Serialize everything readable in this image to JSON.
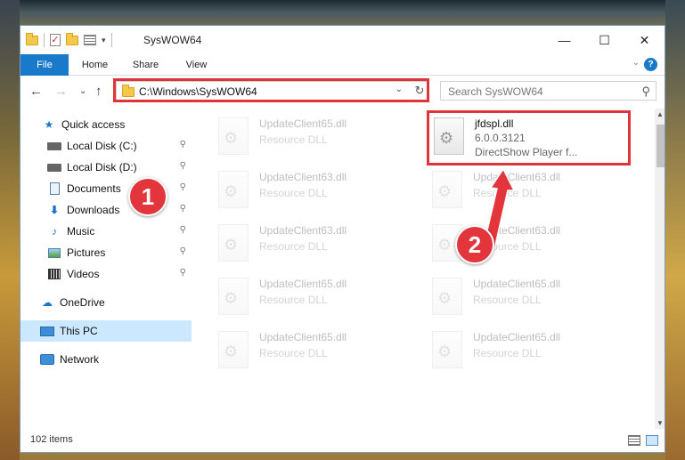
{
  "window": {
    "title": "SysWOW64",
    "controls": {
      "minimize": "—",
      "maximize": "☐",
      "close": "✕"
    }
  },
  "ribbon": {
    "tabs": [
      "File",
      "Home",
      "Share",
      "View"
    ],
    "help": "?",
    "collapse": "⌄"
  },
  "nav": {
    "back": "←",
    "forward": "→",
    "recent": "⌄",
    "up": "↑",
    "address": "C:\\Windows\\SysWOW64",
    "address_dropdown": "⌄",
    "refresh": "↻",
    "search_placeholder": "Search SysWOW64",
    "search_icon": "⚲"
  },
  "sidebar": {
    "items": [
      {
        "label": "Quick access",
        "icon": "star-icon",
        "pinned": false
      },
      {
        "label": "Local Disk (C:)",
        "icon": "drive-icon",
        "pinned": true
      },
      {
        "label": "Local Disk (D:)",
        "icon": "drive-icon",
        "pinned": true
      },
      {
        "label": "Documents",
        "icon": "documents-icon",
        "pinned": true
      },
      {
        "label": "Downloads",
        "icon": "download-icon",
        "pinned": true
      },
      {
        "label": "Music",
        "icon": "music-icon",
        "pinned": true
      },
      {
        "label": "Pictures",
        "icon": "pictures-icon",
        "pinned": true
      },
      {
        "label": "Videos",
        "icon": "videos-icon",
        "pinned": true
      },
      {
        "label": "OneDrive",
        "icon": "cloud-icon",
        "pinned": false
      },
      {
        "label": "This PC",
        "icon": "pc-icon",
        "pinned": false,
        "selected": true
      },
      {
        "label": "Network",
        "icon": "network-icon",
        "pinned": false
      }
    ],
    "pin_glyph": "📌"
  },
  "files": {
    "left_column": [
      {
        "name": "UpdateClient65.dll",
        "type": "Resource DLL"
      },
      {
        "name": "UpdateClient63.dll",
        "type": "Resource DLL"
      },
      {
        "name": "UpdateClient63.dll",
        "type": "Resource DLL"
      },
      {
        "name": "UpdateClient65.dll",
        "type": "Resource DLL"
      },
      {
        "name": "UpdateClient65.dll",
        "type": "Resource DLL"
      }
    ],
    "highlighted": {
      "name": "jfdspl.dll",
      "version": "6.0.0.3121",
      "description": "DirectShow Player f..."
    },
    "right_column": [
      {
        "name": "UpdateClient63.dll",
        "type": "Resource DLL"
      },
      {
        "name": "UpdateClient63.dll",
        "type": "Resource DLL"
      },
      {
        "name": "UpdateClient65.dll",
        "type": "Resource DLL"
      },
      {
        "name": "UpdateClient65.dll",
        "type": "Resource DLL"
      }
    ]
  },
  "status": {
    "item_count": "102 items"
  },
  "callouts": [
    "1",
    "2"
  ],
  "colors": {
    "accent": "#1979ca",
    "highlight": "#e0343b",
    "selected": "#cce8ff"
  }
}
